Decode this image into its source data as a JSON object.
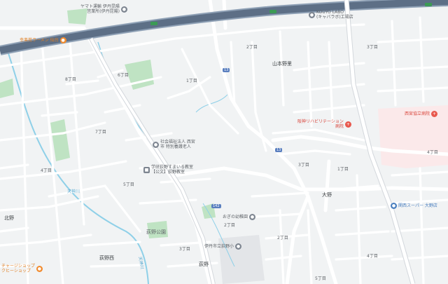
{
  "map": {
    "background": "#f1f3f4",
    "road_color": "#ffffff",
    "highway_color": "#5d6f86",
    "highway_border": "#8ea0b5",
    "park_color": "#bfe3c3",
    "water_color": "#8fd0e8",
    "hospital_area_color": "#fbe9ea",
    "school_area_color": "#e3e5e8"
  },
  "pois": [
    {
      "name": "ヤマト運輸 伊丹昆陽",
      "sub": "営業所(伊丹昆陽)",
      "icon": "store-icon",
      "color": "gray"
    },
    {
      "name": "KOUYO LABO",
      "sub": "(キャバラボ)工場店",
      "icon": "store-icon",
      "color": "gray"
    },
    {
      "name": "幸楽苑ラーメン 仙台",
      "icon": "restaurant-icon",
      "color": "orange"
    },
    {
      "name": "社会福祉法人 西宮",
      "sub": "市 特別養護老人",
      "icon": "building-icon",
      "color": "gray"
    },
    {
      "name": "学研荻野すまいる教室",
      "sub": "【公文】荻野教室",
      "icon": "school-icon",
      "color": "gray"
    },
    {
      "name": "阪神リハビリテーション",
      "sub": "病院",
      "icon": "hospital-icon",
      "color": "red"
    },
    {
      "name": "西宮協立病院",
      "icon": "hospital-icon",
      "color": "red"
    },
    {
      "name": "おぎの幼稚園",
      "icon": "kindergarten-icon",
      "color": "gray"
    },
    {
      "name": "伊丹市立荻野小",
      "icon": "school-icon",
      "color": "gray"
    },
    {
      "name": "関西スーパー 大野店",
      "icon": "shop-icon",
      "color": "blue"
    },
    {
      "name": "チャージショップ",
      "sub": "クヒーショップ",
      "icon": "shop-icon",
      "color": "orange"
    }
  ],
  "labels": {
    "yamamoto_nobushi": "山本野里",
    "ogino_park": "荻野公園",
    "ono": "大野",
    "ogino": "荻野",
    "ogino_nishi": "荻野西",
    "kitano": "北野",
    "tenjingawa": "天神川",
    "chome_1": "1丁目",
    "chome_2": "2丁目",
    "chome_3": "3丁目",
    "chome_4": "4丁目",
    "chome_5": "5丁目",
    "chome_6": "6丁目",
    "chome_7": "7丁目",
    "chome_8": "8丁目"
  },
  "shields": {
    "r13": "13",
    "r142": "142"
  }
}
